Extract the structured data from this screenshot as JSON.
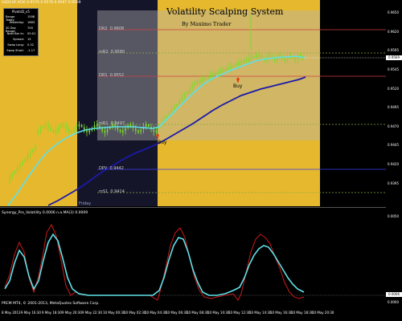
{
  "window": {
    "title": "USDCHF,M30  0.9576 0.9576 0.9567 0.9569",
    "indicator_title": "Synergy_Pro_Volatility 0.0006  n.a.MA(3) 0.0009",
    "copyright": "PRCM MT4, © 2001-2013, MetaQuotes Software Corp.",
    "session_label": "Friday"
  },
  "system": {
    "title": "Volatility Scalping System",
    "author": "By Maximo Trader"
  },
  "pivot_box": {
    "title": "PivotsD_v5",
    "rows": [
      {
        "label": "Range Today:",
        "value": "1508"
      },
      {
        "label": "Yesterday:",
        "value": "1663"
      },
      {
        "label": "30 Day Range:",
        "value": "700"
      },
      {
        "label": "Next Bar In:",
        "value": "05:01"
      },
      {
        "label": "Spread:",
        "value": "15"
      },
      {
        "label": "Swap Long:",
        "value": "0.32"
      },
      {
        "label": "Swap Short:",
        "value": "-1.17"
      }
    ]
  },
  "pivot_levels": [
    {
      "name": "DR2",
      "value": "0.9608"
    },
    {
      "name": "mR2",
      "value": "0.9580"
    },
    {
      "name": "DR1",
      "value": "0.9552"
    },
    {
      "name": "mR1",
      "value": "0.9497"
    },
    {
      "name": "DPV",
      "value": "0.9442"
    },
    {
      "name": "mS1",
      "value": "0.9414"
    }
  ],
  "signals": [
    {
      "label": "Buy"
    },
    {
      "label": "Buy"
    }
  ],
  "price_axis": {
    "ticks": [
      "0.9650",
      "0.9620",
      "0.9595",
      "0.9570",
      "0.9545",
      "0.9520",
      "0.9495",
      "0.9470",
      "0.9445",
      "0.9420",
      "0.9395"
    ],
    "current_price": "0.9569"
  },
  "indicator_axis": {
    "ticks": [
      "0.0050",
      "0.0006",
      "0.0000"
    ],
    "current": "0.0006"
  },
  "time_axis": {
    "ticks": [
      "8 May 2013",
      "9 May 16:30",
      "9 May 18:30",
      "9 May 20:30",
      "9 May 22:30",
      "10 May 00:30",
      "10 May 02:30",
      "10 May 04:30",
      "10 May 06:30",
      "10 May 08:30",
      "10 May 10:30",
      "10 May 12:30",
      "10 May 14:30",
      "10 May 16:30",
      "10 May 18:30",
      "10 May 20:30"
    ]
  },
  "colors": {
    "background": "#000000",
    "session_yellow": "#e6b82e",
    "box_gray": "#b3b3b3",
    "candles": "#7ddc2a",
    "fast_ma": "#5fe0e8",
    "slow_ma": "#1a1aa8",
    "osc_main": "#5fe0e8",
    "osc_signal": "#cc1a1a"
  }
}
